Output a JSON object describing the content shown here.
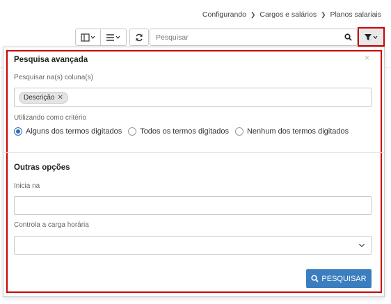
{
  "breadcrumb": {
    "items": [
      "Configurando",
      "Cargos e salários",
      "Planos salariais"
    ],
    "separator": "❯"
  },
  "toolbar": {
    "columns_icon": "columns-icon",
    "rows_icon": "list-icon",
    "refresh_icon": "refresh-icon",
    "search_placeholder": "Pesquisar",
    "search_icon": "search-icon",
    "filter_icon": "filter-icon"
  },
  "advanced_search": {
    "title": "Pesquisa avançada",
    "close_label": "×",
    "columns_label": "Pesquisar na(s) coluna(s)",
    "selected_columns": [
      "Descrição"
    ],
    "criteria_label": "Utilizando como critério",
    "criteria_options": [
      {
        "label": "Alguns dos termos digitados",
        "checked": true
      },
      {
        "label": "Todos os termos digitados",
        "checked": false
      },
      {
        "label": "Nenhum dos termos digitados",
        "checked": false
      }
    ]
  },
  "other_options": {
    "title": "Outras opções",
    "start_label": "Inicia na",
    "start_value": "",
    "workload_label": "Controla a carga horária",
    "workload_value": ""
  },
  "submit": {
    "label": "PESQUISAR",
    "color": "#3a7ebf"
  },
  "highlight_color": "#cc0000"
}
